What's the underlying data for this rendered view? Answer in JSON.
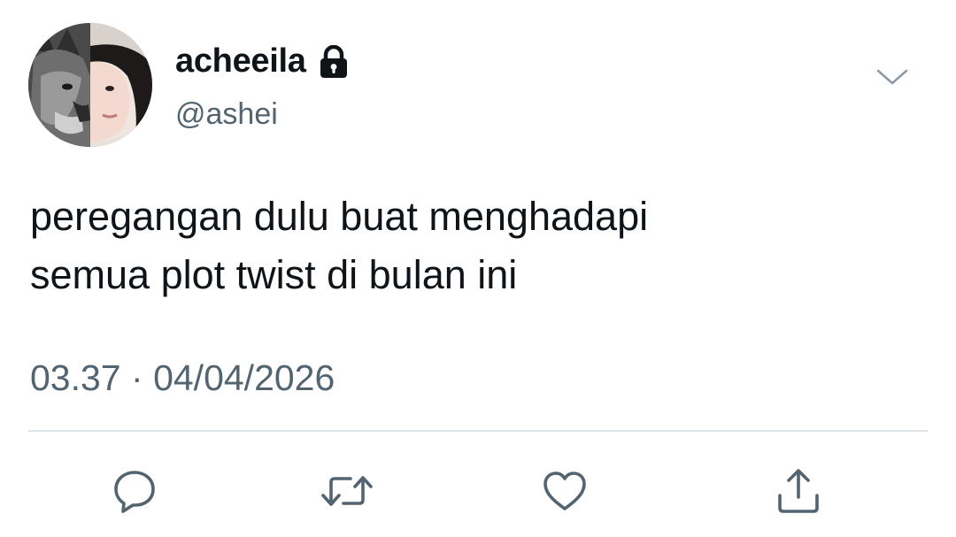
{
  "tweet": {
    "display_name": "acheeila",
    "handle": "@ashei",
    "text": "peregangan dulu buat menghadapi\nsemua plot twist di bulan ini",
    "time": "03.37",
    "separator": "·",
    "date": "04/04/2026",
    "avatar": "avatar-icon",
    "locked_icon": "lock-icon",
    "menu_icon": "chevron-down-icon"
  },
  "actions": [
    {
      "icon": "reply-icon"
    },
    {
      "icon": "retweet-icon"
    },
    {
      "icon": "like-icon"
    },
    {
      "icon": "share-icon"
    }
  ],
  "colors": {
    "text": "#0f1419",
    "secondary": "#536471",
    "divider": "#dfe3e6",
    "icon": "#536471"
  }
}
